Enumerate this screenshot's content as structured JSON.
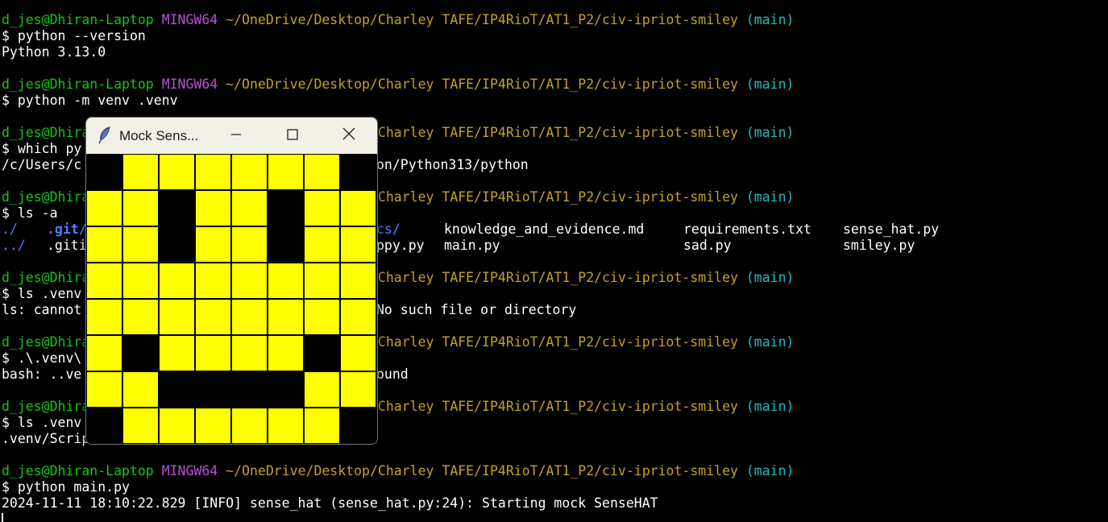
{
  "prompt": {
    "user": "d_jes@Dhiran-Laptop",
    "system": "MINGW64",
    "path": "~/OneDrive/Desktop/Charley TAFE/IP4RioT/AT1_P2/civ-ipriot-smiley",
    "branch": "(main)",
    "symbol": "$"
  },
  "terminal": {
    "cmd1": "python --version",
    "out1": "Python 3.13.0",
    "cmd2": "python -m venv .venv",
    "cmd3": "which py",
    "out3_left": "/c/Users/c",
    "out3_right": "on/Python313/python",
    "cmd4": "ls -a",
    "ls": {
      "col1_row1": "./",
      "col2_row1": ".git/",
      "col3_row1": "cs/",
      "col4_row1": "knowledge_and_evidence.md",
      "col5_row1": "requirements.txt",
      "col6_row1": "sense_hat.py",
      "col1_row2": "../",
      "col2_row2": ".giti",
      "col3_row2": "ppy.py",
      "col4_row2": "main.py",
      "col5_row2": "sad.py",
      "col6_row2": "smiley.py"
    },
    "cmd5": "ls .venv",
    "out5_left": "ls: cannot",
    "out5_right": "No such file or directory",
    "cmd6": ".\\.venv\\",
    "out6_left": "bash: ..ve",
    "out6_right": "ound",
    "cmd7": "ls .venv",
    "out7": ".venv/Scripts/activate",
    "cmd8": "python main.py",
    "log": "2024-11-11 18:10:22.829 [INFO] sense_hat (sense_hat.py:24): Starting mock SenseHAT"
  },
  "window": {
    "title": "Mock Sens...",
    "icon": "feather-icon",
    "min_icon": "minimize-icon",
    "max_icon": "maximize-icon",
    "close_icon": "close-icon"
  },
  "colors": {
    "on": "#ffff00",
    "off": "#000000",
    "user": "#13c713",
    "system": "#b84fd1",
    "path": "#c5a222",
    "branch": "#2ab7b7"
  },
  "led_matrix": [
    "01111110",
    "11011011",
    "11011011",
    "11111111",
    "11111111",
    "10111101",
    "11000011",
    "01111110"
  ]
}
